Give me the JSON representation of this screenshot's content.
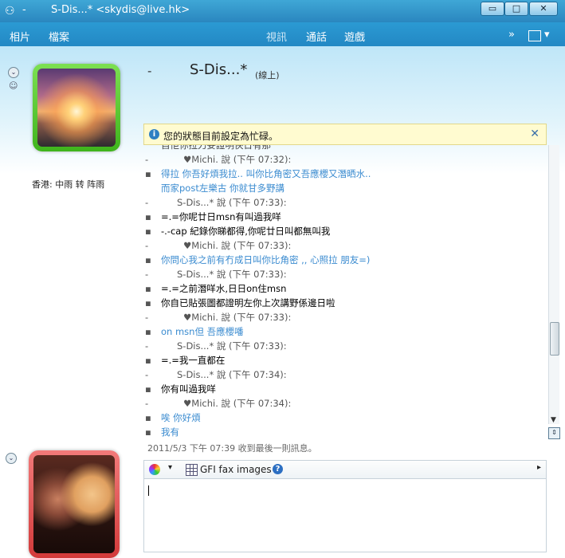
{
  "window": {
    "dash": "-",
    "title": "S-Dis...* <skydis@live.hk>",
    "controls": {
      "minimize": "▭",
      "maximize": "□",
      "close": "✕"
    }
  },
  "menu": {
    "left": [
      "相片",
      "檔案"
    ],
    "right": [
      "視訊",
      "通話",
      "遊戲"
    ],
    "overflow": "»",
    "options": "▾"
  },
  "contact": {
    "dash": "-",
    "name": "S-Dis...*",
    "status": "(線上)",
    "weather": "香港: 中雨 转 阵雨"
  },
  "notice": {
    "text": "您的狀態目前設定為忙碌。",
    "close": "✕"
  },
  "chat": {
    "partial_top": "自佢你拉力妥證明俠日有那",
    "lines": [
      {
        "bullet": "-",
        "text": "♥Michi. 說 (下午 07:32):",
        "type": "hdr",
        "indent": true
      },
      {
        "bullet": "▪",
        "text": "得拉 你吾好煩我拉.. 叫你比角密又吾應櫻又潛晒水..",
        "type": "msg-them",
        "indent": false
      },
      {
        "bullet": "",
        "text": "而家post左樂古 你就甘多野講",
        "type": "msg-them",
        "indent": false
      },
      {
        "bullet": "-",
        "text": "S-Dis...* 說 (下午 07:33):",
        "type": "hdr",
        "indent": true
      },
      {
        "bullet": "▪",
        "text": "=.=你呢廿日msn有叫過我咩",
        "type": "msg-me",
        "indent": false
      },
      {
        "bullet": "▪",
        "text": "-.-cap 紀錄你睇都得,你呢廿日叫都無叫我",
        "type": "msg-me",
        "indent": false
      },
      {
        "bullet": "-",
        "text": "♥Michi. 說 (下午 07:33):",
        "type": "hdr",
        "indent": true
      },
      {
        "bullet": "▪",
        "text": "你問心我之前有冇成日叫你比角密 ,, 心照拉  朋友=)",
        "type": "msg-them",
        "indent": false
      },
      {
        "bullet": "-",
        "text": "S-Dis...* 說 (下午 07:33):",
        "type": "hdr",
        "indent": true
      },
      {
        "bullet": "▪",
        "text": "=.=之前潛咩水,日日on住msn",
        "type": "msg-me",
        "indent": false
      },
      {
        "bullet": "▪",
        "text": "你自已貼張圖都證明左你上次講野係邊日啦",
        "type": "msg-me",
        "indent": false
      },
      {
        "bullet": "-",
        "text": "♥Michi. 說 (下午 07:33):",
        "type": "hdr",
        "indent": true
      },
      {
        "bullet": "▪",
        "text": "on msn但 吾應櫻噃",
        "type": "msg-them",
        "indent": false
      },
      {
        "bullet": "-",
        "text": "S-Dis...* 說 (下午 07:33):",
        "type": "hdr",
        "indent": true
      },
      {
        "bullet": "▪",
        "text": "=.=我一直都在",
        "type": "msg-me",
        "indent": false
      },
      {
        "bullet": "-",
        "text": "S-Dis...* 說 (下午 07:34):",
        "type": "hdr",
        "indent": true
      },
      {
        "bullet": "▪",
        "text": "你有叫過我咩",
        "type": "msg-me",
        "indent": false
      },
      {
        "bullet": "-",
        "text": "♥Michi. 說 (下午 07:34):",
        "type": "hdr",
        "indent": true
      },
      {
        "bullet": "▪",
        "text": "唉 你好煩",
        "type": "msg-them",
        "indent": false
      },
      {
        "bullet": "▪",
        "text": "我有",
        "type": "msg-them",
        "indent": false
      }
    ]
  },
  "last_received": "2011/5/3 下午 07:39 收到最後一則訊息。",
  "toolbar": {
    "dropdown": "▾",
    "gfi_label": "GFI fax images",
    "help": "?",
    "more": "▸"
  },
  "input": {
    "value": ""
  },
  "colors": {
    "titlebar": "#2a86bf",
    "menubar": "#2388c4",
    "contact_msg": "#3a8bd0",
    "notice_bg": "#fffbd0"
  }
}
